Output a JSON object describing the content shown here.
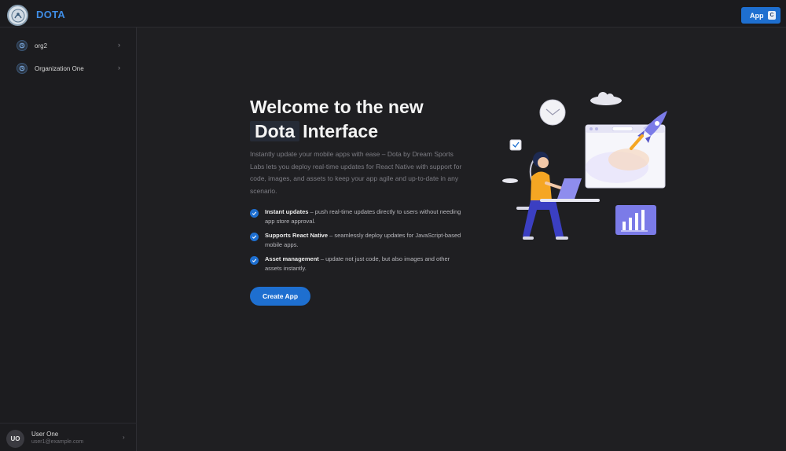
{
  "header": {
    "brand": "DOTA",
    "app_button_label": "App",
    "app_button_badge": "C"
  },
  "sidebar": {
    "items": [
      {
        "label": "org2",
        "icon": "org-icon"
      },
      {
        "label": "Organization One",
        "icon": "org-icon"
      }
    ],
    "user": {
      "initials": "UO",
      "name": "User One",
      "email": "user1@example.com"
    }
  },
  "main": {
    "title_line1": "Welcome to the new",
    "title_highlight": "Dota",
    "title_rest": "Interface",
    "description": "Instantly update your mobile apps with ease – Dota by Dream Sports Labs lets you deploy real-time updates for React Native with support for code, images, and assets to keep your app agile and up-to-date in any scenario.",
    "features": [
      {
        "title": "Instant updates",
        "text": " – push real-time updates directly to users without needing app store approval."
      },
      {
        "title": "Supports React Native",
        "text": " – seamlessly deploy updates for JavaScript-based mobile apps."
      },
      {
        "title": "Asset management",
        "text": " – update not just code, but also images and other assets instantly."
      }
    ],
    "create_button": "Create App"
  },
  "colors": {
    "accent": "#1e6fd0",
    "brand": "#3f8de6",
    "background": "#1f1f22",
    "illustration_purple": "#7b7be8",
    "illustration_orange": "#f5a623"
  }
}
